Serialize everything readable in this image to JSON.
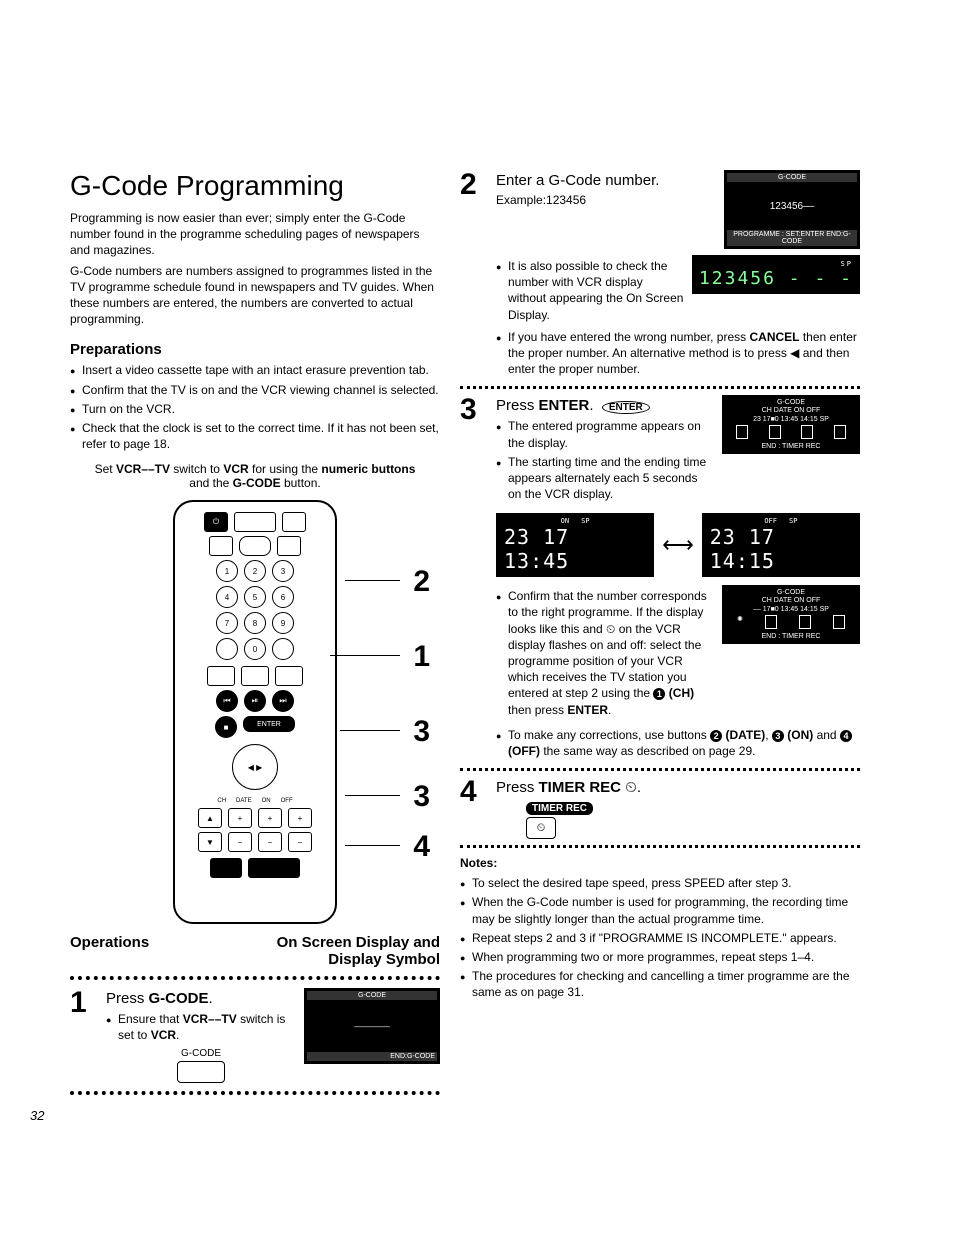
{
  "title": "G-Code Programming",
  "intro1": "Programming is now easier than ever; simply enter the G-Code number found in the programme scheduling pages of newspapers and magazines.",
  "intro2": "G-Code numbers are numbers assigned to programmes listed in the TV programme schedule found in newspapers and TV guides. When these numbers are entered, the numbers are converted to actual programming.",
  "prep_h": "Preparations",
  "prep": [
    "Insert a video cassette tape with an intact erasure prevention tab.",
    "Confirm that the TV is on and the VCR viewing channel is selected.",
    "Turn on the VCR.",
    "Check that the clock is set to the correct time. If it has not been set, refer to page 18."
  ],
  "switch_note_a": "Set ",
  "switch_note_b": "VCR––TV",
  "switch_note_c": " switch to ",
  "switch_note_d": "VCR",
  "switch_note_e": " for using the ",
  "switch_note_f": "numeric buttons",
  "switch_note_g": " and the ",
  "switch_note_h": "G-CODE",
  "switch_note_i": " button.",
  "callouts": {
    "c2": "2",
    "c1": "1",
    "c3a": "3",
    "c3b": "3",
    "c4": "4"
  },
  "op_h": "Operations",
  "osd_h": "On Screen Display and Display Symbol",
  "step1": {
    "num": "1",
    "title_a": "Press ",
    "title_b": "G-CODE",
    "title_c": ".",
    "b1": "Ensure that ",
    "b1b": "VCR––TV",
    "b1c": " switch is set to ",
    "b1d": "VCR",
    "b1e": ".",
    "btn_label": "G-CODE",
    "osd_top": "G-CODE",
    "osd_mid": "––––––––",
    "osd_bot": "END:G-CODE"
  },
  "step2": {
    "num": "2",
    "title": "Enter a G-Code number.",
    "ex": "Example:123456",
    "osd_top": "G-CODE",
    "osd_mid": "123456––",
    "osd_bot": "PROGRAMME : SET:ENTER  END:G-CODE",
    "b1": "It is also possible to check the number with VCR display without appearing the On Screen Display.",
    "vcr": "123456 - - -",
    "vcr_sp": "SP",
    "b2a": "If you have entered the wrong number, press ",
    "b2b": "CANCEL",
    "b2c": " then enter the proper number. An alternative method is to press ◀ and then enter the proper number."
  },
  "step3": {
    "num": "3",
    "title_a": "Press ",
    "title_b": "ENTER",
    "title_c": ".",
    "enter_btn": "ENTER",
    "b1": "The entered programme appears on the display.",
    "b2": "The starting time and the ending time appears alternately each 5 seconds on the VCR display.",
    "disp1_top": "G-CODE",
    "disp1_h": "CH  DATE  ON      OFF",
    "disp1_r": "23  17■0  13:45  14:15  SP",
    "disp1_bot": "END : TIMER REC",
    "seg_label_on": "ON",
    "seg_label_sp": "SP",
    "seg1": "23  17  13:45",
    "seg_label_off": "OFF",
    "seg_label_sp2": "SP",
    "seg2": "23  17  14:15",
    "b3": "Confirm that the number corresponds to the right programme. If the display looks like this and ⏲ on the VCR display flashes on and off: select the programme position of your VCR which receives the TV station you entered at step 2 using the ",
    "b3ch": "(CH)",
    "b3end": " then press ",
    "b3enter": "ENTER",
    "b3dot": ".",
    "disp2_top": "G-CODE",
    "disp2_h": "CH  DATE  ON      OFF",
    "disp2_r": "––  17■0  13:45  14:15  SP",
    "disp2_bot": "END : TIMER REC",
    "b4a": "To make any corrections, use buttons ",
    "b4date": "(DATE)",
    "b4b": ", ",
    "b4on": "(ON)",
    "b4c": " and ",
    "b4off": "(OFF)",
    "b4d": " the same way as described on page 29."
  },
  "step4": {
    "num": "4",
    "title_a": "Press ",
    "title_b": "TIMER REC",
    "title_c": " ⏲.",
    "chip": "TIMER REC"
  },
  "notes_h": "Notes:",
  "notes": [
    "To select the desired tape speed, press SPEED after step 3.",
    "When the G-Code number is used for programming, the recording time may be slightly longer than the actual programme time.",
    "Repeat steps 2 and 3 if \"PROGRAMME IS INCOMPLETE.\" appears.",
    "When programming two or more programmes, repeat steps 1–4.",
    "The procedures for checking and cancelling a timer programme are the same as on page 31."
  ],
  "note_bold": [
    "SPEED",
    "3",
    "2",
    "3",
    "1–4"
  ],
  "page_num": "32",
  "remote_nums": [
    "1",
    "2",
    "3",
    "4",
    "5",
    "6",
    "7",
    "8",
    "9",
    "0"
  ],
  "remote_enter": "ENTER",
  "remote_timer_labels": [
    "CH",
    "DATE",
    "ON",
    "OFF"
  ]
}
